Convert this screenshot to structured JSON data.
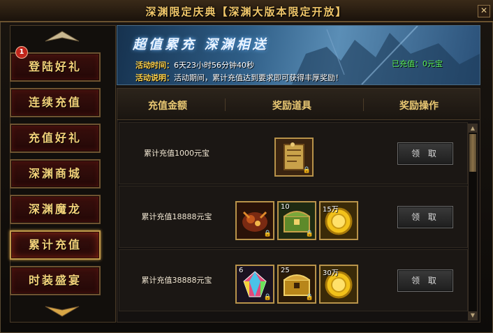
{
  "window": {
    "title": "深渊限定庆典【深渊大版本限定开放】",
    "close_label": "✕"
  },
  "sidebar": {
    "badge_count": "1",
    "items": [
      {
        "label": "登陆好礼"
      },
      {
        "label": "连续充值"
      },
      {
        "label": "充值好礼"
      },
      {
        "label": "深渊商城"
      },
      {
        "label": "深渊魔龙"
      },
      {
        "label": "累计充值"
      },
      {
        "label": "时装盛宴"
      }
    ],
    "active_item": "累计充值"
  },
  "banner": {
    "title": "超值累充 深渊相送",
    "time_label": "活动时间：",
    "time_value": "6天23小时56分钟40秒",
    "desc_label": "活动说明：",
    "desc_value": "活动期间，累计充值达到要求即可获得丰厚奖励！",
    "recharged": "已充值：0元宝"
  },
  "table": {
    "headers": [
      "充值金额",
      "奖励道具",
      "奖励操作"
    ],
    "rows": [
      {
        "name": "累计充值1000元宝",
        "items": [
          {
            "icon": "scroll-book-icon",
            "count": ""
          }
        ],
        "action": "领 取"
      },
      {
        "name": "累计充值18888元宝",
        "items": [
          {
            "icon": "demon-mount-icon",
            "count": ""
          },
          {
            "icon": "treasure-chest-icon",
            "count": "10"
          },
          {
            "icon": "gold-coin-icon",
            "count": "15万"
          }
        ],
        "action": "领 取"
      },
      {
        "name": "累计充值38888元宝",
        "items": [
          {
            "icon": "rainbow-gem-icon",
            "count": "6"
          },
          {
            "icon": "golden-chest-icon",
            "count": "25"
          },
          {
            "icon": "gold-coin-icon",
            "count": "30万"
          }
        ],
        "action": "领 取"
      }
    ]
  },
  "colors": {
    "gold_text": "#f3d27a",
    "recharged_green": "#5bf25a",
    "frame_border": "#b8934a"
  }
}
